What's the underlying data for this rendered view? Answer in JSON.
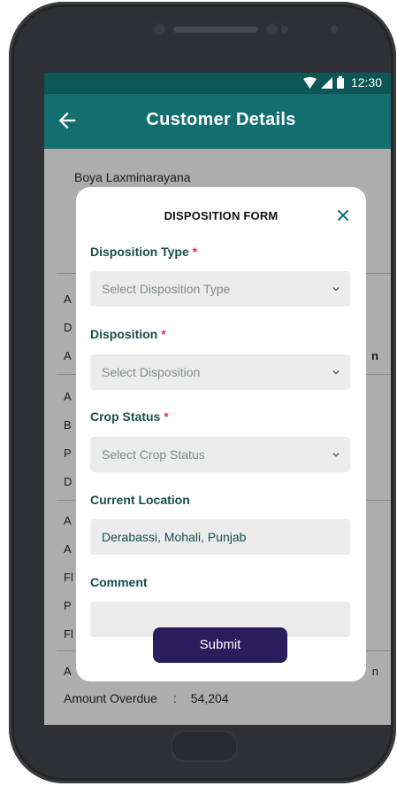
{
  "status_bar": {
    "time": "12:30"
  },
  "app_bar": {
    "title": "Customer Details"
  },
  "background": {
    "customer_name": "Boya Laxminarayana",
    "row_letters": [
      "A",
      "D",
      "A",
      "A",
      "B",
      "P",
      "D",
      "A",
      "A",
      "Fl",
      "P",
      "Fl",
      "A"
    ],
    "right_values": [
      "n",
      "n"
    ],
    "amount_overdue_label": "Amount Overdue",
    "amount_overdue_sep": ":",
    "amount_overdue_value": "54,204"
  },
  "modal": {
    "title": "DISPOSITION FORM",
    "required_marker": "*",
    "disposition_type": {
      "label": "Disposition Type",
      "placeholder": "Select Disposition Type"
    },
    "disposition": {
      "label": "Disposition",
      "placeholder": "Select Disposition"
    },
    "crop_status": {
      "label": "Crop Status",
      "placeholder": "Select Crop Status"
    },
    "current_location": {
      "label": "Current Location",
      "value": "Derabassi, Mohali, Punjab"
    },
    "comment": {
      "label": "Comment",
      "value": ""
    },
    "submit_label": "Submit"
  },
  "colors": {
    "status_bar": "#0d5656",
    "app_bar": "#136f6f",
    "label": "#174e4e",
    "required": "#e0304a",
    "submit": "#2a1d5b"
  },
  "icons": [
    "back-arrow-icon",
    "wifi-icon",
    "signal-icon",
    "battery-icon",
    "close-icon",
    "chevron-down-icon"
  ]
}
